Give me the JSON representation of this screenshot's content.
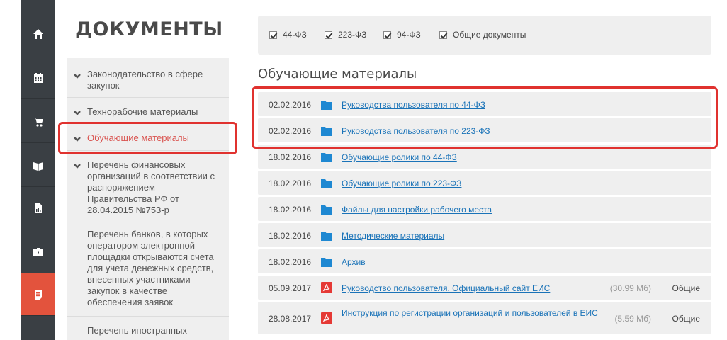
{
  "sidebar": {
    "title": "ДОКУМЕНТЫ",
    "items": [
      {
        "label": "Законодательство в сфере закупок"
      },
      {
        "label": "Технорабочие материалы"
      },
      {
        "label": "Обучающие материалы"
      },
      {
        "label": "Перечень финансовых организаций в соответствии с распоряжением Правительства РФ от 28.04.2015 №753-р"
      },
      {
        "label": "Перечень банков, в которых оператором электронной площадки открываются счета для учета денежных средств, внесенных участниками закупок в качестве обеспечения заявок"
      },
      {
        "label": "Перечень иностранных"
      }
    ]
  },
  "filters": [
    {
      "label": "44-ФЗ",
      "checked": true
    },
    {
      "label": "223-ФЗ",
      "checked": true
    },
    {
      "label": "94-ФЗ",
      "checked": true
    },
    {
      "label": "Общие документы",
      "checked": true
    }
  ],
  "section": {
    "title": "Обучающие материалы"
  },
  "documents": [
    {
      "date": "02.02.2016",
      "title": "Руководства пользователя по 44-ФЗ",
      "type": "folder-icon"
    },
    {
      "date": "02.02.2016",
      "title": "Руководства пользователя по 223-ФЗ",
      "type": "folder-icon"
    },
    {
      "date": "18.02.2016",
      "title": "Обучающие ролики по 44-ФЗ",
      "type": "folder-icon"
    },
    {
      "date": "18.02.2016",
      "title": "Обучающие ролики по 223-ФЗ",
      "type": "folder-icon"
    },
    {
      "date": "18.02.2016",
      "title": "Файлы для настройки рабочего места",
      "type": "folder-icon"
    },
    {
      "date": "18.02.2016",
      "title": "Методические материалы",
      "type": "folder-icon"
    },
    {
      "date": "18.02.2016",
      "title": "Архив",
      "type": "folder-icon"
    },
    {
      "date": "05.09.2017",
      "title": "Руководство пользователя. Официальный сайт ЕИС",
      "type": "pdf-icon",
      "size": "(30.99 Мб)",
      "category": "Общие"
    },
    {
      "date": "28.08.2017",
      "title": "Инструкция по регистрации организаций и пользователей в ЕИС",
      "type": "pdf-icon",
      "size": "(5.59 Мб)",
      "category": "Общие"
    }
  ],
  "rail": {
    "icons": [
      "home-icon",
      "calendar-icon",
      "cart-icon",
      "book-icon",
      "report-icon",
      "briefcase-icon",
      "document-icon"
    ],
    "active_color": "#e3533d",
    "bg_color": "#3a3f44"
  },
  "colors": {
    "link": "#1a73b8",
    "highlight": "#e0322f",
    "active_label": "#d9534f",
    "folder": "#1e88d2",
    "pdf": "#e53935"
  }
}
